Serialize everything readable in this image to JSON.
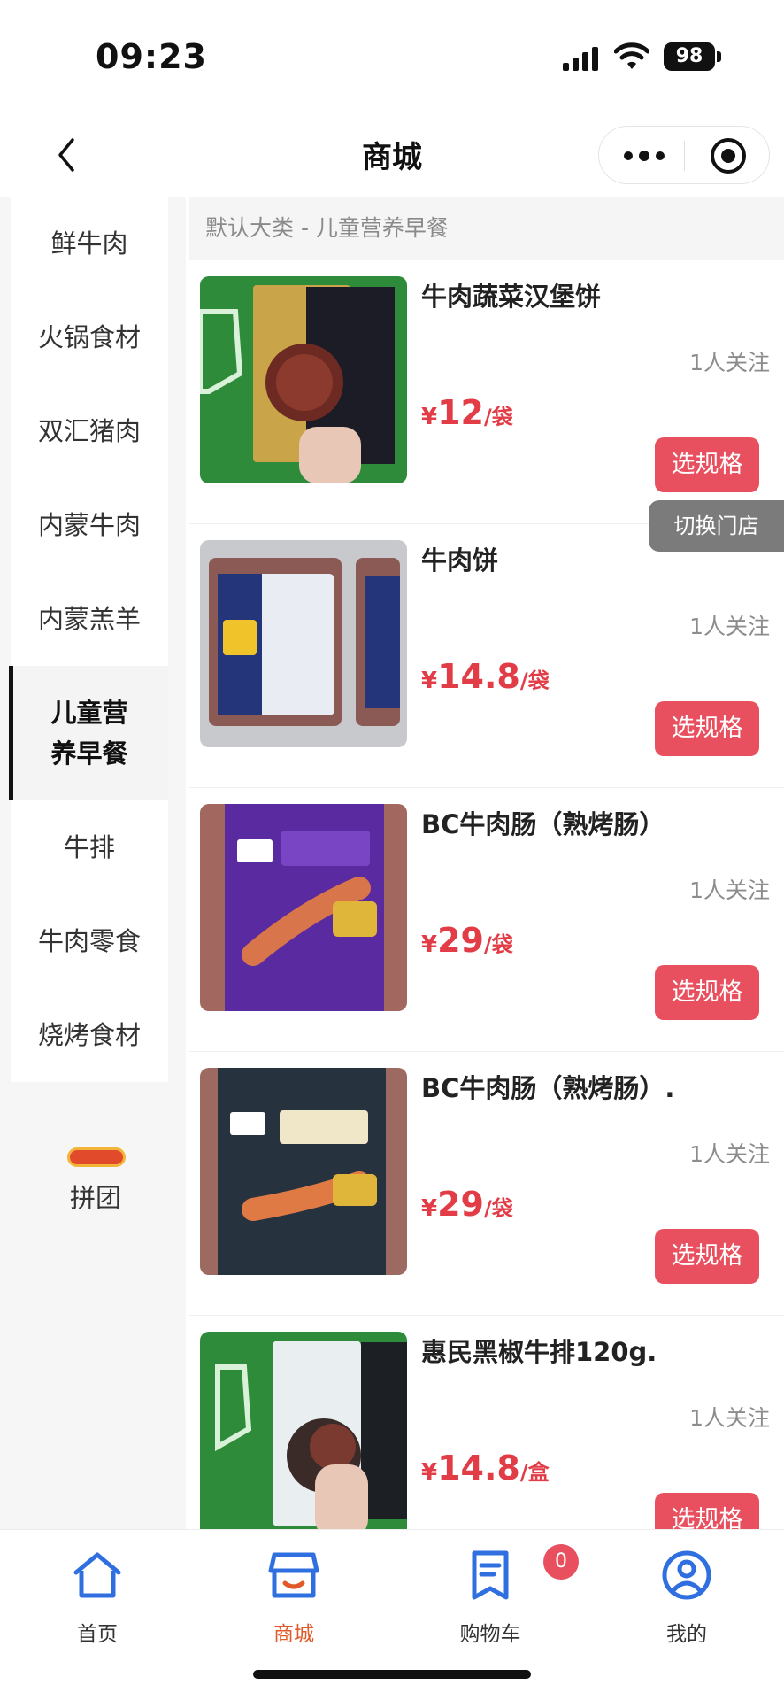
{
  "status_bar": {
    "time": "09:23",
    "battery": "98"
  },
  "nav": {
    "title": "商城"
  },
  "sidebar": {
    "categories": [
      {
        "label": "鲜牛肉"
      },
      {
        "label": "火锅食材"
      },
      {
        "label": "双汇猪肉"
      },
      {
        "label": "内蒙牛肉"
      },
      {
        "label": "内蒙羔羊"
      },
      {
        "label": "儿童营养早餐",
        "active": true
      },
      {
        "label": "牛排"
      },
      {
        "label": "牛肉零食"
      },
      {
        "label": "烧烤食材"
      }
    ],
    "group_buy_label": "拼团"
  },
  "content": {
    "breadcrumb": "默认大类 - 儿童营养早餐",
    "switch_store_label": "切换门店",
    "products": [
      {
        "name": "牛肉蔬菜汉堡饼",
        "follow": "1人关注",
        "currency": "¥",
        "price": "12",
        "unit": "/袋",
        "button": "选规格"
      },
      {
        "name": "牛肉饼",
        "follow": "1人关注",
        "currency": "¥",
        "price": "14.8",
        "unit": "/袋",
        "button": "选规格"
      },
      {
        "name": "BC牛肉肠（熟烤肠）",
        "follow": "1人关注",
        "currency": "¥",
        "price": "29",
        "unit": "/袋",
        "button": "选规格"
      },
      {
        "name": "BC牛肉肠（熟烤肠）.",
        "follow": "1人关注",
        "currency": "¥",
        "price": "29",
        "unit": "/袋",
        "button": "选规格"
      },
      {
        "name": "惠民黑椒牛排120g.",
        "follow": "1人关注",
        "currency": "¥",
        "price": "14.8",
        "unit": "/盒",
        "button": "选规格"
      }
    ]
  },
  "tab_bar": {
    "tabs": [
      {
        "label": "首页",
        "icon": "home-icon"
      },
      {
        "label": "商城",
        "icon": "store-icon",
        "active": true
      },
      {
        "label": "购物车",
        "icon": "receipt-icon"
      },
      {
        "label": "我的",
        "icon": "user-icon"
      }
    ],
    "cart_count": "0"
  },
  "colors": {
    "accent": "#e8505f",
    "price": "#e23c46",
    "active_tab": "#e05a2a",
    "icon_blue": "#2f6fe0"
  }
}
